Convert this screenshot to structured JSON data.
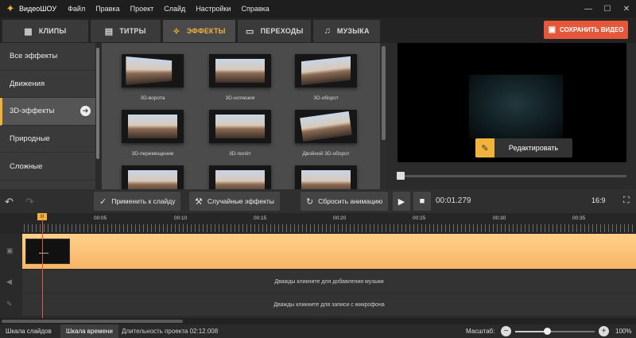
{
  "app": {
    "name": "ВидеоШОУ"
  },
  "menu": [
    "Файл",
    "Правка",
    "Проект",
    "Слайд",
    "Настройки",
    "Справка"
  ],
  "tabs": [
    {
      "label": "КЛИПЫ",
      "icon": "film-icon"
    },
    {
      "label": "ТИТРЫ",
      "icon": "text-bubble-icon"
    },
    {
      "label": "ЭФФЕКТЫ",
      "icon": "magic-star-icon",
      "active": true
    },
    {
      "label": "ПЕРЕХОДЫ",
      "icon": "transition-icon"
    },
    {
      "label": "МУЗЫКА",
      "icon": "music-note-icon"
    }
  ],
  "save_button": "СОХРАНИТЬ ВИДЕО",
  "categories": [
    {
      "label": "Все эффекты"
    },
    {
      "label": "Движения"
    },
    {
      "label": "3D-эффекты",
      "active": true
    },
    {
      "label": "Природные"
    },
    {
      "label": "Сложные"
    }
  ],
  "effects": [
    {
      "label": "3D-ворота"
    },
    {
      "label": "3D-иллюзия"
    },
    {
      "label": "3D-оборот"
    },
    {
      "label": "3D-перемещение"
    },
    {
      "label": "3D-полёт"
    },
    {
      "label": "Двойной 3D-оборот"
    },
    {
      "label": ""
    },
    {
      "label": ""
    },
    {
      "label": ""
    }
  ],
  "preview": {
    "edit_label": "Редактировать"
  },
  "toolbar": {
    "apply_label": "Применить к слайду",
    "random_label": "Случайные эффекты",
    "reset_label": "Сбросить анимацию",
    "timecode": "00:01.279",
    "aspect": "16:9"
  },
  "timeline": {
    "ticks": [
      "00:05",
      "00:10",
      "00:15",
      "00:20",
      "00:25",
      "00:30",
      "00:35"
    ],
    "audio_hint": "Дважды кликните для добавления музыки",
    "voice_hint": "Дважды кликните для записи с микрофона"
  },
  "status": {
    "tab_slides": "Шкала слайдов",
    "tab_timeline": "Шкала времени",
    "duration": "Длительность проекта 02:12.008",
    "scale_label": "Масштаб:",
    "zoom_percent": "100%",
    "zoom_level": 0.4
  },
  "colors": {
    "accent": "#f2b33d",
    "save": "#e5573a",
    "video_track": "#f7b566"
  }
}
